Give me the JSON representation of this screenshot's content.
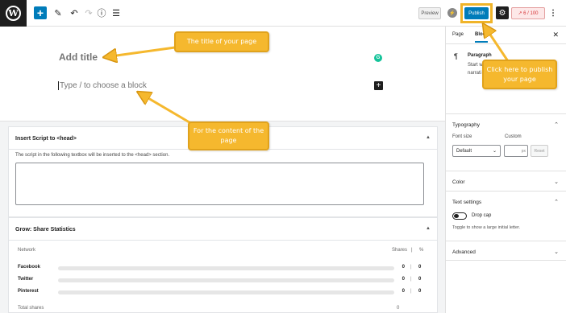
{
  "toolbar": {
    "logo_letter": "W",
    "preview_label": "Preview",
    "publish_label": "Publish",
    "score_label": "6 / 100",
    "icons": [
      "add-block-icon",
      "pen-icon",
      "undo-icon",
      "redo-icon",
      "info-icon",
      "list-view-icon",
      "settings-icon",
      "more-icon"
    ]
  },
  "editor": {
    "title_placeholder": "Add title",
    "block_placeholder": "Type / to choose a block"
  },
  "metabox_insert_script": {
    "title": "Insert Script to <head>",
    "description": "The script in the following textbox will be inserted to the <head> section."
  },
  "metabox_share_stats": {
    "title": "Grow: Share Statistics",
    "columns": {
      "network": "Network",
      "shares": "Shares",
      "separator": "|",
      "percent": "%"
    },
    "rows": [
      {
        "network": "Facebook",
        "shares": "0",
        "sep": "|",
        "percent": "0",
        "fill": 0
      },
      {
        "network": "Twitter",
        "shares": "0",
        "sep": "|",
        "percent": "0",
        "fill": 0
      },
      {
        "network": "Pinterest",
        "shares": "0",
        "sep": "|",
        "percent": "0",
        "fill": 0
      }
    ],
    "total_label": "Total shares",
    "total_value": "0"
  },
  "sidebar": {
    "tab_page": "Page",
    "tab_block": "Block",
    "block_name": "Paragraph",
    "block_desc": "Start w narrati",
    "typography_title": "Typography",
    "font_size_label": "Font size",
    "custom_label": "Custom",
    "font_size_value": "Default",
    "custom_unit": "px",
    "reset_label": "Reset",
    "color_title": "Color",
    "text_settings_title": "Text settings",
    "drop_cap_label": "Drop cap",
    "drop_cap_help": "Toggle to show a large initial letter.",
    "advanced_title": "Advanced"
  },
  "annotations": {
    "title_note": "The title of your page",
    "content_note": "For the content of the page",
    "publish_note": "Click here to publish your page"
  },
  "colors": {
    "accent": "#007cba",
    "callout": "#f5b82e",
    "dark": "#1e1e1e"
  }
}
